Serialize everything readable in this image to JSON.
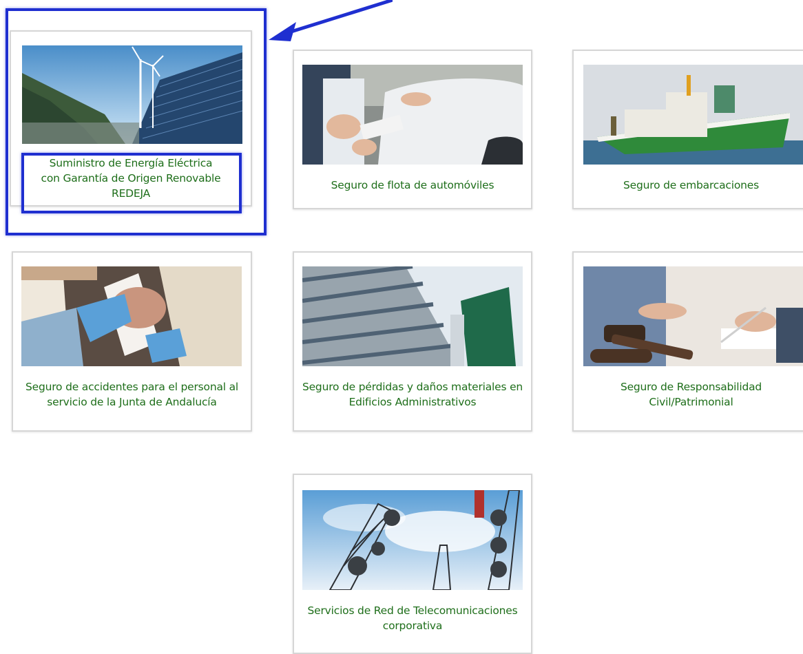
{
  "cards": [
    {
      "label": "Suministro de Energía Eléctrica con Garantía de Origen Renovable REDEJA",
      "image": "renewable-energy-image"
    },
    {
      "label": "Seguro de flota de automóviles",
      "image": "car-inspection-image"
    },
    {
      "label": "Seguro de embarcaciones",
      "image": "patrol-boat-image"
    },
    {
      "label": "Seguro de accidentes para el personal al servicio de la Junta de Andalucía",
      "image": "medical-bandage-image"
    },
    {
      "label": "Seguro de pérdidas y daños materiales en Edificios Administrativos",
      "image": "office-building-image"
    },
    {
      "label": "Seguro de Responsabilidad Civil/Patrimonial",
      "image": "gavel-signing-image"
    },
    {
      "label": "Servicios de Red de Telecomunicaciones corporativa",
      "image": "telecom-towers-image"
    }
  ],
  "annotation": {
    "color": "#1f2fd0",
    "arrow_icon": "arrow-pointer-icon"
  },
  "colors": {
    "label_text": "#1e6e1a",
    "card_border": "#d6d6d6"
  }
}
